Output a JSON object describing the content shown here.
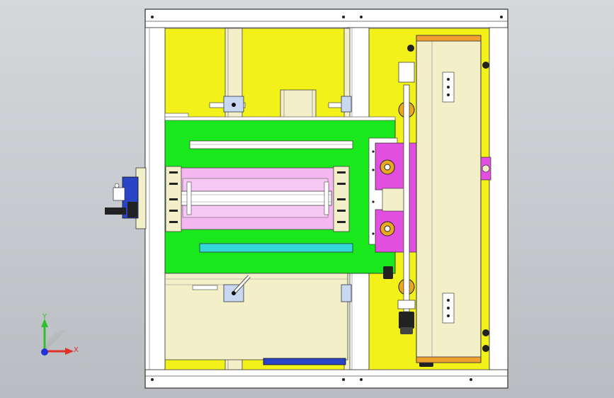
{
  "viewport": {
    "background_color": "#c9ccd0",
    "frame_color": "#ffffff",
    "panel_yellow": "#f2f21a",
    "plate_green": "#19e81c",
    "bar_pink": "#f4b7f0",
    "block_magenta": "#e24fe0",
    "bar_cyan": "#33d9d9",
    "housing_beige": "#f3efc9",
    "motor_blue": "#2a44c8"
  },
  "triad": {
    "x_label": "X",
    "y_label": "Y",
    "x_color": "#e0302a",
    "y_color": "#2fbf2f",
    "origin_color": "#2234d8",
    "icon": "axis-triad-icon"
  }
}
